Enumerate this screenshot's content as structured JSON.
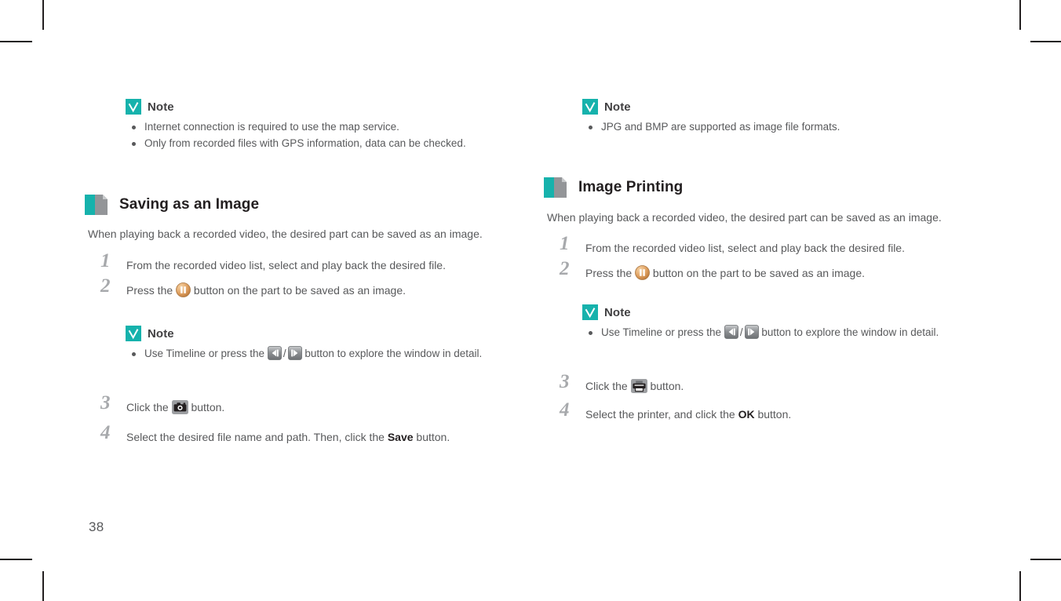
{
  "page": {
    "number": "38",
    "colors": {
      "teal": "#16b2ac",
      "text": "#58595b",
      "heading": "#231f20",
      "step_number": "#a7a9ac",
      "pause_button": "#e8a96a",
      "icon_button_bg": "#9d9fa2"
    }
  },
  "left_column": {
    "note_top": {
      "title": "Note",
      "items": [
        "Internet connection is required to use the map service.",
        "Only from recorded files with GPS information, data can be checked."
      ]
    },
    "section": {
      "title": "Saving as an Image",
      "intro": "When playing back a recorded video, the desired part can be saved as an image.",
      "steps": [
        {
          "number": "1",
          "text_before": "From the recorded video list, select and play back the desired file.",
          "icon": null,
          "text_after": ""
        },
        {
          "number": "2",
          "text_before": "Press the ",
          "icon": "pause-icon",
          "text_after": " button on the part to be saved as an image."
        },
        {
          "number": "3",
          "text_before": "Click the ",
          "icon": "camera-icon",
          "text_after": " button."
        },
        {
          "number": "4",
          "text_before": "Select the desired file name and path. Then, click the ",
          "bold": "Save",
          "text_after": " button."
        }
      ]
    },
    "note_middle": {
      "title": "Note",
      "item_before": "Use Timeline or press the ",
      "icon_prev": "step-backward-icon",
      "separator": "/",
      "icon_next": "step-forward-icon",
      "item_after": " button to explore the window in detail."
    }
  },
  "right_column": {
    "note_top": {
      "title": "Note",
      "items": [
        "JPG and BMP are supported as image file formats."
      ]
    },
    "section": {
      "title": "Image Printing",
      "intro": "When playing back a recorded video, the desired part can be saved as an image.",
      "steps": [
        {
          "number": "1",
          "text_before": "From the recorded video list, select and play back the desired file.",
          "icon": null,
          "text_after": ""
        },
        {
          "number": "2",
          "text_before": "Press the ",
          "icon": "pause-icon",
          "text_after": " button on the part to be saved as an image."
        },
        {
          "number": "3",
          "text_before": "Click the ",
          "icon": "printer-icon",
          "text_after": " button."
        },
        {
          "number": "4",
          "text_before": "Select the printer, and click the ",
          "bold": "OK",
          "text_after": " button."
        }
      ]
    },
    "note_middle": {
      "title": "Note",
      "item_before": "Use Timeline or press the ",
      "icon_prev": "step-backward-icon",
      "separator": "/",
      "icon_next": "step-forward-icon",
      "item_after": " button to explore the window in detail."
    }
  }
}
